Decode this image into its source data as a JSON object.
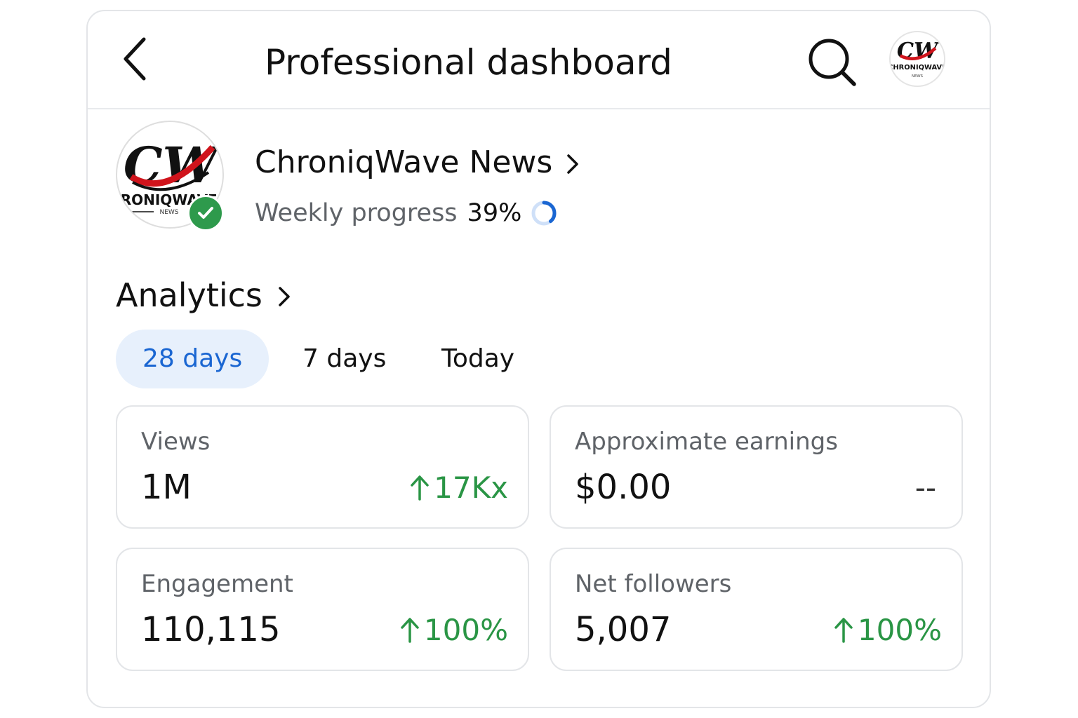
{
  "header": {
    "title": "Professional dashboard"
  },
  "profile": {
    "name": "ChroniqWave News",
    "progress_label": "Weekly progress",
    "progress_value": "39%",
    "progress_fraction": 0.39,
    "verified": true,
    "logo_text": "CW",
    "logo_subtext": "CHRONIQWAVE",
    "logo_tagline": "NEWS"
  },
  "analytics": {
    "title": "Analytics",
    "tabs": [
      {
        "label": "28 days",
        "active": true
      },
      {
        "label": "7 days",
        "active": false
      },
      {
        "label": "Today",
        "active": false
      }
    ],
    "metrics": [
      {
        "label": "Views",
        "value": "1M",
        "change": "17Kx",
        "trend": "up"
      },
      {
        "label": "Approximate earnings",
        "value": "$0.00",
        "change": "--",
        "trend": "none"
      },
      {
        "label": "Engagement",
        "value": "110,115",
        "change": "100%",
        "trend": "up"
      },
      {
        "label": "Net followers",
        "value": "5,007",
        "change": "100%",
        "trend": "up"
      }
    ]
  },
  "icons": {
    "back": "chevron-left-icon",
    "search": "search-icon",
    "verified": "check-badge-icon",
    "chevron": "chevron-right-icon",
    "trend_up": "arrow-up-icon"
  },
  "colors": {
    "accent": "#1a66d2",
    "active_tab_bg": "#e7f0fc",
    "positive": "#2a9545",
    "verified_badge": "#2e9a4c",
    "logo_red": "#d0141c",
    "logo_black": "#111111"
  }
}
